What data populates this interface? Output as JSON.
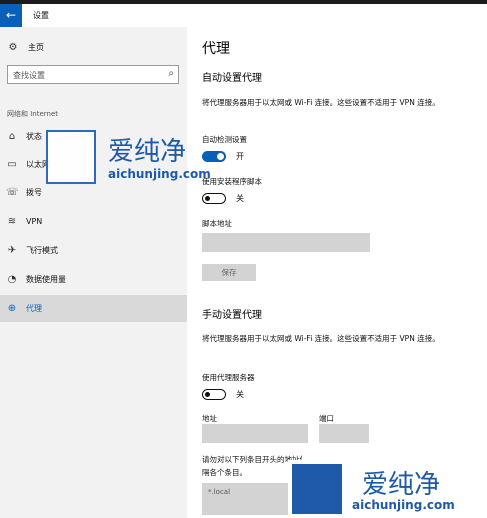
{
  "window": {
    "title": "设置",
    "back_icon": "arrow-left-icon"
  },
  "sidebar": {
    "home_label": "主页",
    "search_placeholder": "查找设置",
    "section_label": "网络和 Internet",
    "items": [
      {
        "label": "状态",
        "icon": "status-icon"
      },
      {
        "label": "以太网",
        "icon": "ethernet-icon"
      },
      {
        "label": "拨号",
        "icon": "dialup-icon"
      },
      {
        "label": "VPN",
        "icon": "vpn-icon"
      },
      {
        "label": "飞行模式",
        "icon": "airplane-icon"
      },
      {
        "label": "数据使用量",
        "icon": "data-usage-icon"
      },
      {
        "label": "代理",
        "icon": "globe-icon",
        "selected": true
      }
    ]
  },
  "main": {
    "title": "代理",
    "auto": {
      "heading": "自动设置代理",
      "description": "将代理服务器用于以太网或 Wi-Fi 连接。这些设置不适用于 VPN 连接。",
      "detect_label": "自动检测设置",
      "detect_state": "开",
      "script_label": "使用安装程序脚本",
      "script_state": "关",
      "address_label": "脚本地址",
      "save_label": "保存"
    },
    "manual": {
      "heading": "手动设置代理",
      "description": "将代理服务器用于以太网或 Wi-Fi 连接。这些设置不适用于 VPN 连接。",
      "proxy_label": "使用代理服务器",
      "proxy_state": "关",
      "address_label": "地址",
      "port_label": "端口",
      "exceptions_desc_line1": "请勿对以下列条目开头的地址使用代理服务器。若有多个条目，请使用英文分号 (;) 来分",
      "exceptions_desc_line2": "隔各个条目。",
      "exceptions_value": "*.local"
    }
  },
  "watermark": {
    "text_cn": "爱纯净",
    "site": "aichunjing.com"
  },
  "colors": {
    "accent": "#0a5fb8",
    "sidebar_bg": "#f2f2f2",
    "field_bg": "#d3d3d3"
  }
}
